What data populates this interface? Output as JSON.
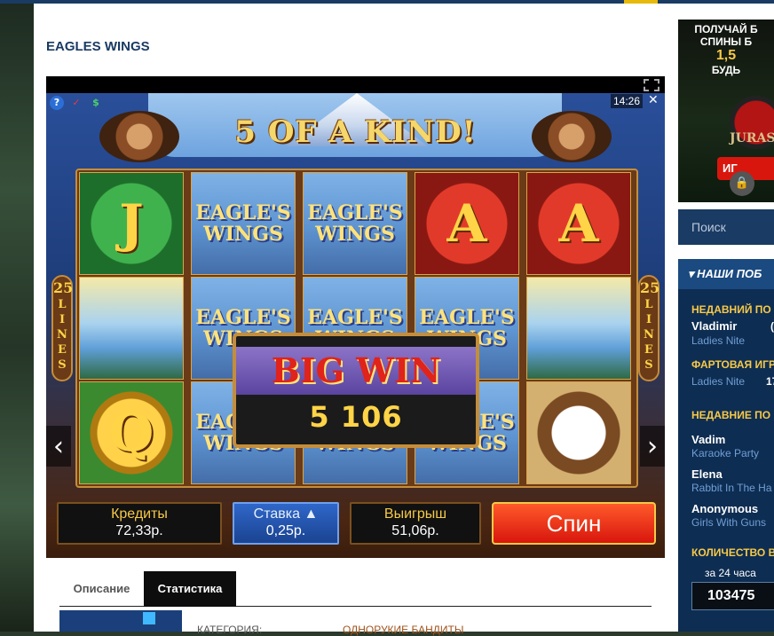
{
  "page": {
    "game_title": "EAGLES WINGS"
  },
  "game": {
    "headline": "5 OF A KIND!",
    "time": "14:26",
    "close_glyph": "✕",
    "lines_label": "25\nL\nI\nN\nE\nS",
    "reels": [
      [
        "J",
        "",
        "Q"
      ],
      [
        "EAGLE'S WINGS",
        "EAGLE'S WINGS",
        "EAGLE'S WINGS"
      ],
      [
        "EAGLE'S WINGS",
        "EAGLE'S WINGS",
        "EAGLE'S WINGS"
      ],
      [
        "A",
        "EAGLE'S WINGS",
        "EAGLE'S WINGS"
      ],
      [
        "A",
        "",
        ""
      ]
    ],
    "big_win": {
      "title": "BIG WIN",
      "amount": "5 106"
    },
    "hud": {
      "credits_label": "Кредиты",
      "credits_value": "72,33р.",
      "bet_label": "Ставка ▲",
      "bet_value": "0,25р.",
      "win_label": "Выигрыш",
      "win_value": "51,06р.",
      "spin_label": "Спин"
    },
    "nav": {
      "prev": "‹",
      "next": "›"
    }
  },
  "tabs": [
    {
      "label": "Описание"
    },
    {
      "label": "Статистика"
    }
  ],
  "info": {
    "key": "КАТЕГОРИЯ:",
    "value": "ОДНОРУКИЕ БАНДИТЫ"
  },
  "promo": {
    "line1": "ПОЛУЧАЙ Б",
    "line2": "СПИНЫ Б",
    "line3": "1,5",
    "line4": "БУДЬ",
    "brand": "JURASS",
    "button": "ИГ"
  },
  "sidebar": {
    "search_placeholder": "Поиск",
    "winners_header": "▾ НАШИ ПОБ",
    "recent_label": "НЕДАВНИЙ ПО",
    "recent_name": "Vladimir",
    "recent_game": "Ladies Nite",
    "recent_amount": "(",
    "lucky_label": "ФАРТОВАЯ ИГР",
    "lucky_game": "Ladies Nite",
    "lucky_amount": "17",
    "recent_wins_label": "НЕДАВНИЕ ПО",
    "wins": [
      {
        "name": "Vadim",
        "game": "Karaoke Party"
      },
      {
        "name": "Elena",
        "game": "Rabbit In The Ha"
      },
      {
        "name": "Anonymous",
        "game": "Girls With Guns"
      }
    ],
    "count_label": "КОЛИЧЕСТВО В",
    "period": "за 24 часа",
    "count_value": "103475"
  }
}
